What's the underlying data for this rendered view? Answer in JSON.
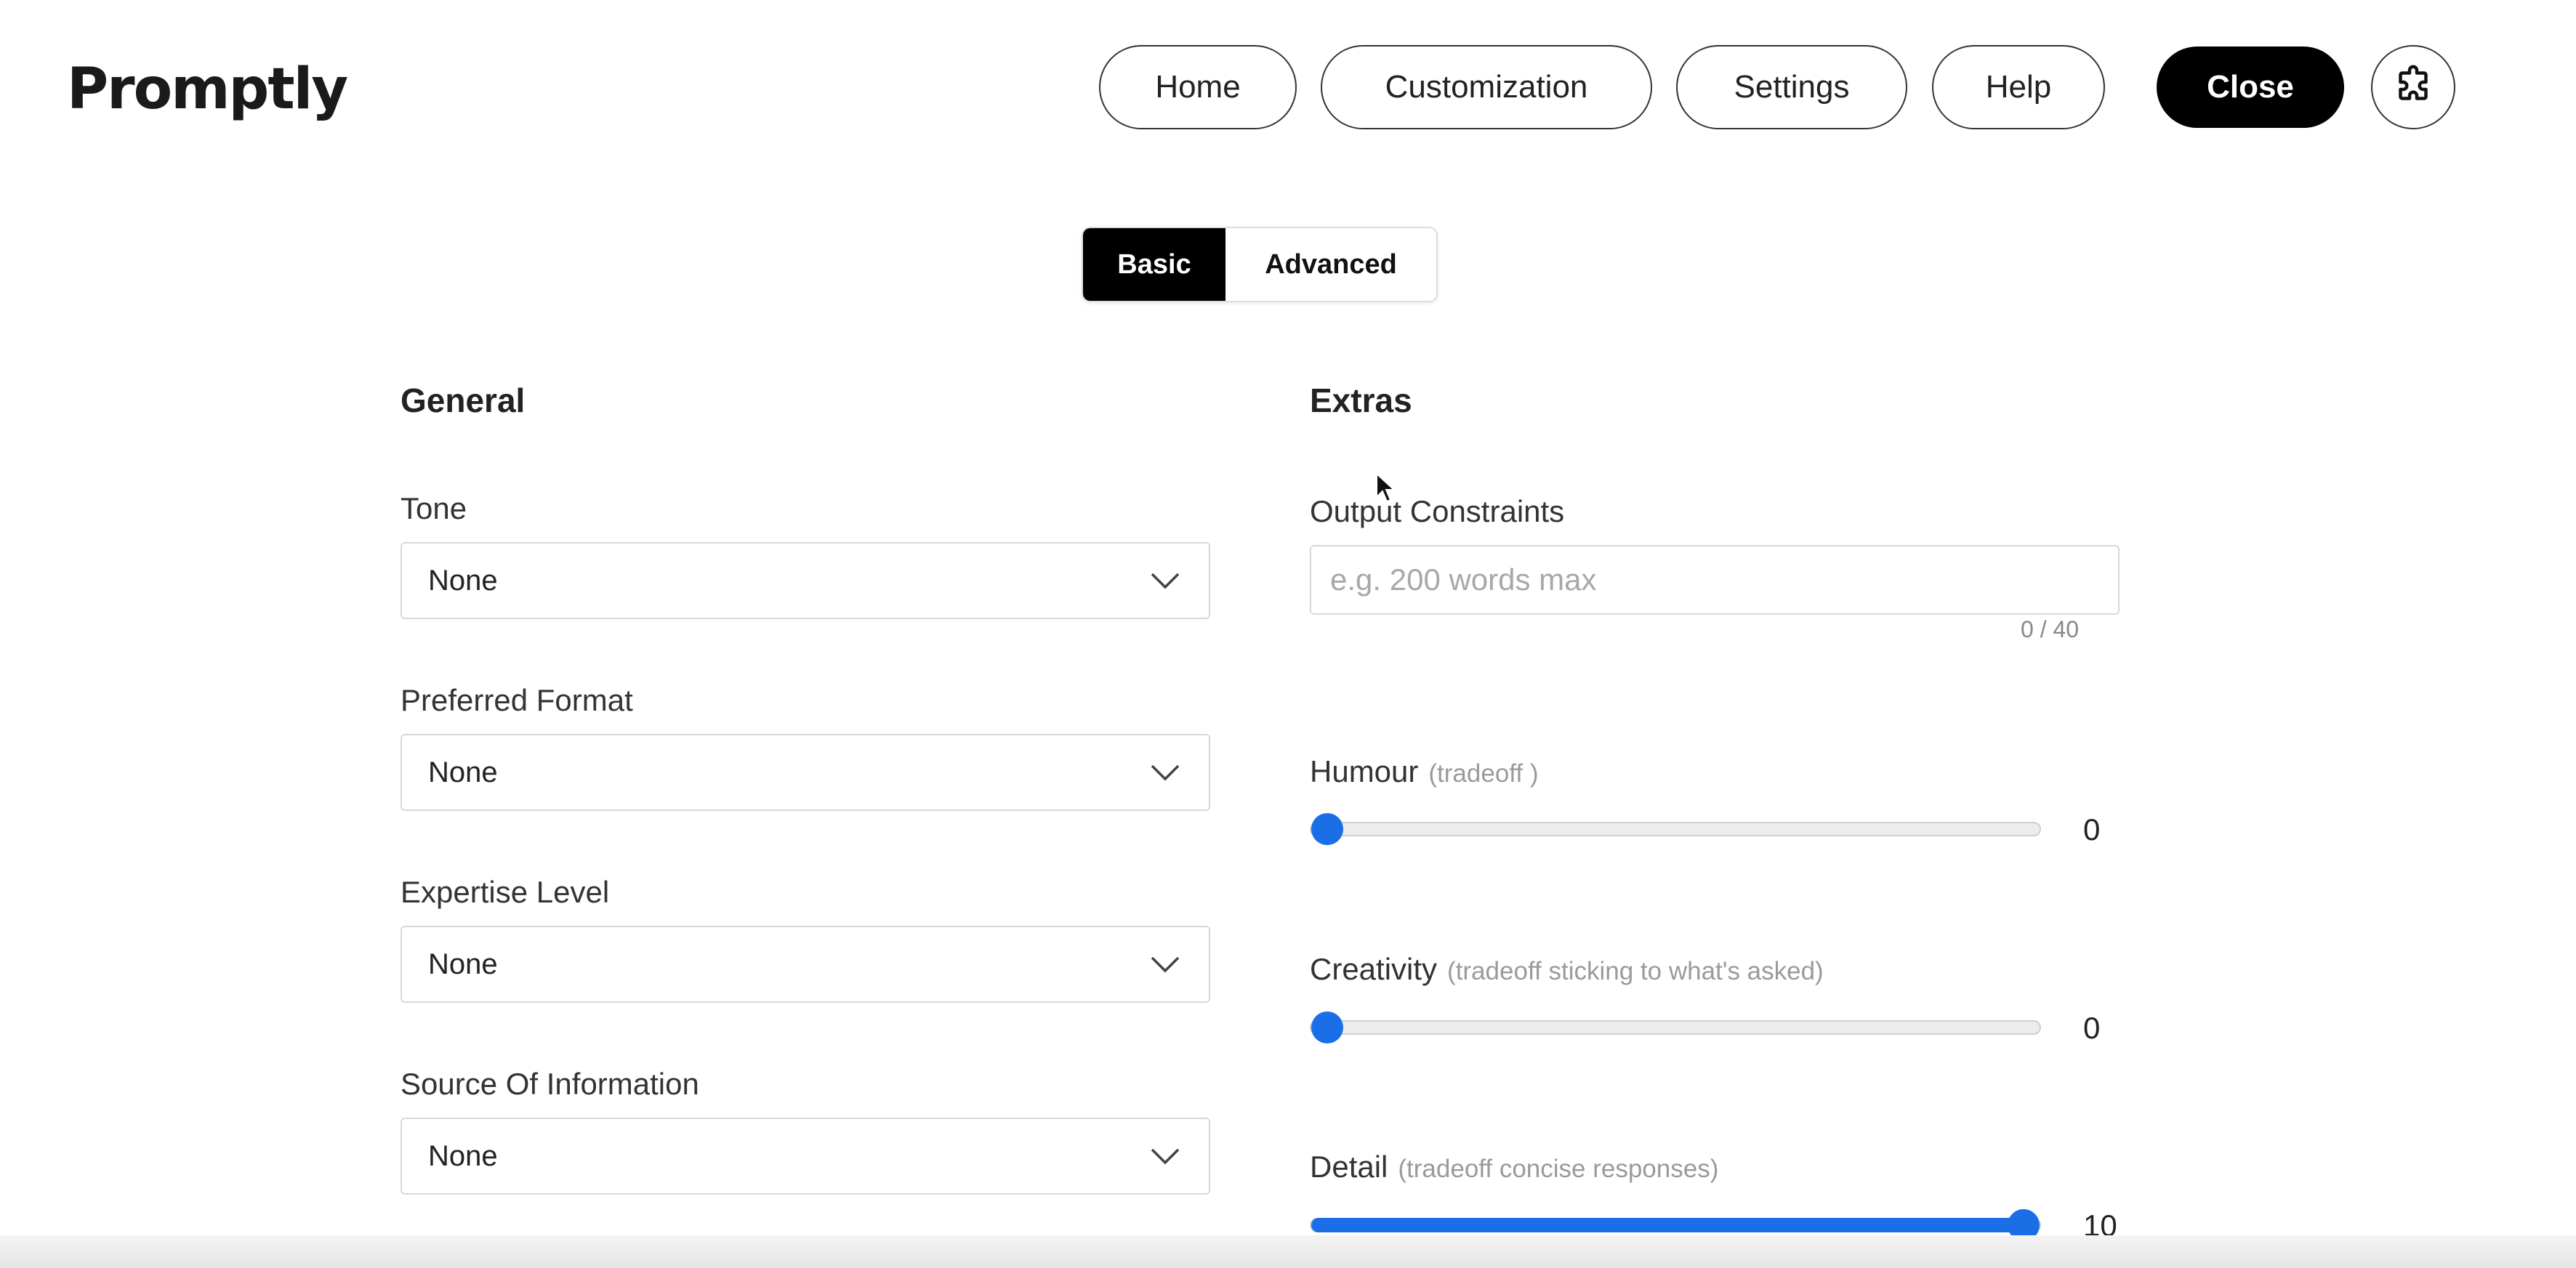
{
  "header": {
    "logo": "Promptly",
    "nav": [
      {
        "label": "Home"
      },
      {
        "label": "Customization"
      },
      {
        "label": "Settings"
      },
      {
        "label": "Help"
      }
    ],
    "close_label": "Close",
    "extension_icon": "puzzle-icon"
  },
  "mode_toggle": {
    "options": [
      "Basic",
      "Advanced"
    ],
    "selected": "Basic"
  },
  "general": {
    "title": "General",
    "fields": [
      {
        "label": "Tone",
        "value": "None"
      },
      {
        "label": "Preferred Format",
        "value": "None"
      },
      {
        "label": "Expertise Level",
        "value": "None"
      },
      {
        "label": "Source Of Information",
        "value": "None"
      }
    ]
  },
  "extras": {
    "title": "Extras",
    "output_constraints": {
      "label": "Output Constraints",
      "placeholder": "e.g. 200 words max",
      "value": "",
      "counter": "0 / 40"
    },
    "sliders": [
      {
        "label": "Humour",
        "hint": "(tradeoff )",
        "value": "0",
        "level": 0
      },
      {
        "label": "Creativity",
        "hint": "(tradeoff sticking to what's asked)",
        "value": "0",
        "level": 0
      },
      {
        "label": "Detail",
        "hint": "(tradeoff concise responses)",
        "value": "10",
        "level": 1
      }
    ]
  },
  "colors": {
    "accent": "#1b6fe6",
    "primary_button": "#000000"
  }
}
